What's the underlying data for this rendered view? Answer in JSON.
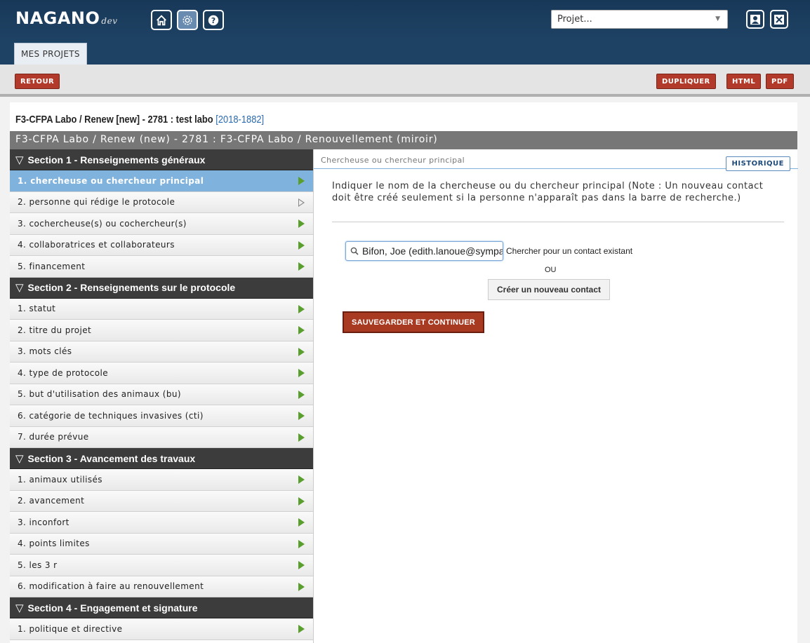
{
  "header": {
    "logo": "NAGANO",
    "logo_suffix": "dev",
    "project_select_placeholder": "Projet..."
  },
  "tabs": [
    {
      "label": "MES PROJETS"
    }
  ],
  "actions": {
    "back": "RETOUR",
    "duplicate": "DUPLIQUER",
    "html": "HTML",
    "pdf": "PDF"
  },
  "project": {
    "title": "F3-CFPA Labo / Renew [new] - 2781 : test labo ",
    "code": "[2018-1882]",
    "subtitle": "F3-CFPA Labo / Renew (new) - 2781 : F3-CFPA Labo / Renouvellement (miroir)"
  },
  "sidebar": {
    "sections": [
      {
        "title": "Section 1 - Renseignements généraux",
        "items": [
          {
            "label": "1. chercheuse ou chercheur principal"
          },
          {
            "label": "2. personne qui rédige le protocole"
          },
          {
            "label": "3. cochercheuse(s) ou cochercheur(s)"
          },
          {
            "label": "4. collaboratrices et collaborateurs"
          },
          {
            "label": "5. financement"
          }
        ]
      },
      {
        "title": "Section 2 - Renseignements sur le protocole",
        "items": [
          {
            "label": "1. statut"
          },
          {
            "label": "2. titre du projet"
          },
          {
            "label": "3. mots clés"
          },
          {
            "label": "4. type de protocole"
          },
          {
            "label": "5. but d'utilisation des animaux (bu)"
          },
          {
            "label": "6. catégorie de techniques invasives (cti)"
          },
          {
            "label": "7. durée prévue"
          }
        ]
      },
      {
        "title": "Section 3 - Avancement des travaux",
        "items": [
          {
            "label": "1. animaux utilisés"
          },
          {
            "label": "2. avancement"
          },
          {
            "label": "3. inconfort"
          },
          {
            "label": "4. points limites"
          },
          {
            "label": "5. les 3 r"
          },
          {
            "label": "6. modification à faire au renouvellement"
          }
        ]
      },
      {
        "title": "Section 4 - Engagement et signature",
        "items": [
          {
            "label": "1. politique et directive"
          }
        ]
      }
    ]
  },
  "main": {
    "question_title": "Chercheuse ou chercheur principal",
    "history_button": "HISTORIQUE",
    "instruction": "Indiquer le nom de la chercheuse ou du chercheur principal (Note : Un nouveau contact doit être créé seulement si la personne n'apparaît pas dans la barre de recherche.)",
    "search_value": "Bifon, Joe (edith.lanoue@sympatico.ca)",
    "search_label": "Chercher pour un contact existant",
    "or_label": "OU",
    "new_contact_button": "Créer un nouveau contact",
    "save_button": "SAUVEGARDER ET CONTINUER"
  }
}
